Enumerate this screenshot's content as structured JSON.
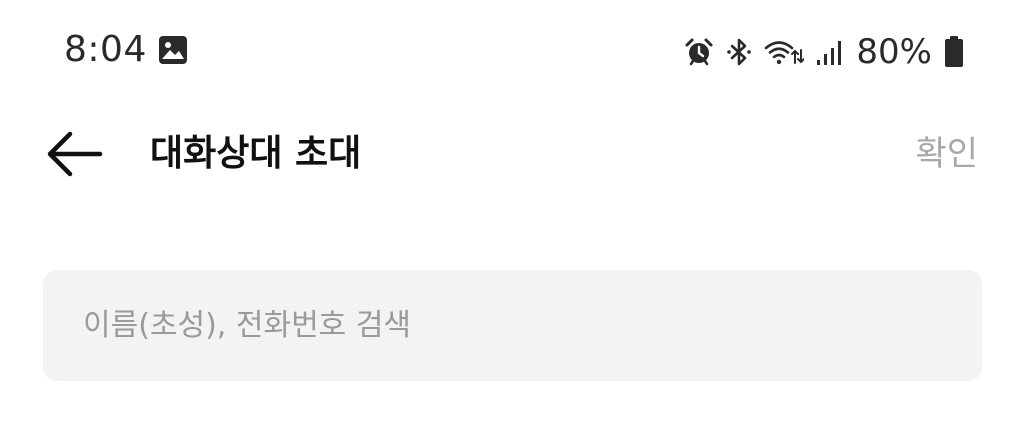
{
  "status_bar": {
    "time": "8:04",
    "battery_percent": "80%",
    "icons": [
      "gallery-icon",
      "alarm-icon",
      "bluetooth-icon",
      "wifi-icon",
      "signal-icon",
      "battery-icon"
    ]
  },
  "header": {
    "title": "대화상대 초대",
    "confirm_label": "확인",
    "back_icon": "arrow-left-icon"
  },
  "search": {
    "value": "",
    "placeholder": "이름(초성), 전화번호 검색"
  },
  "colors": {
    "background": "#ffffff",
    "title_text": "#111111",
    "confirm_disabled": "#a8a8a8",
    "search_background": "#f3f3f3",
    "placeholder": "#9a9a9a"
  }
}
